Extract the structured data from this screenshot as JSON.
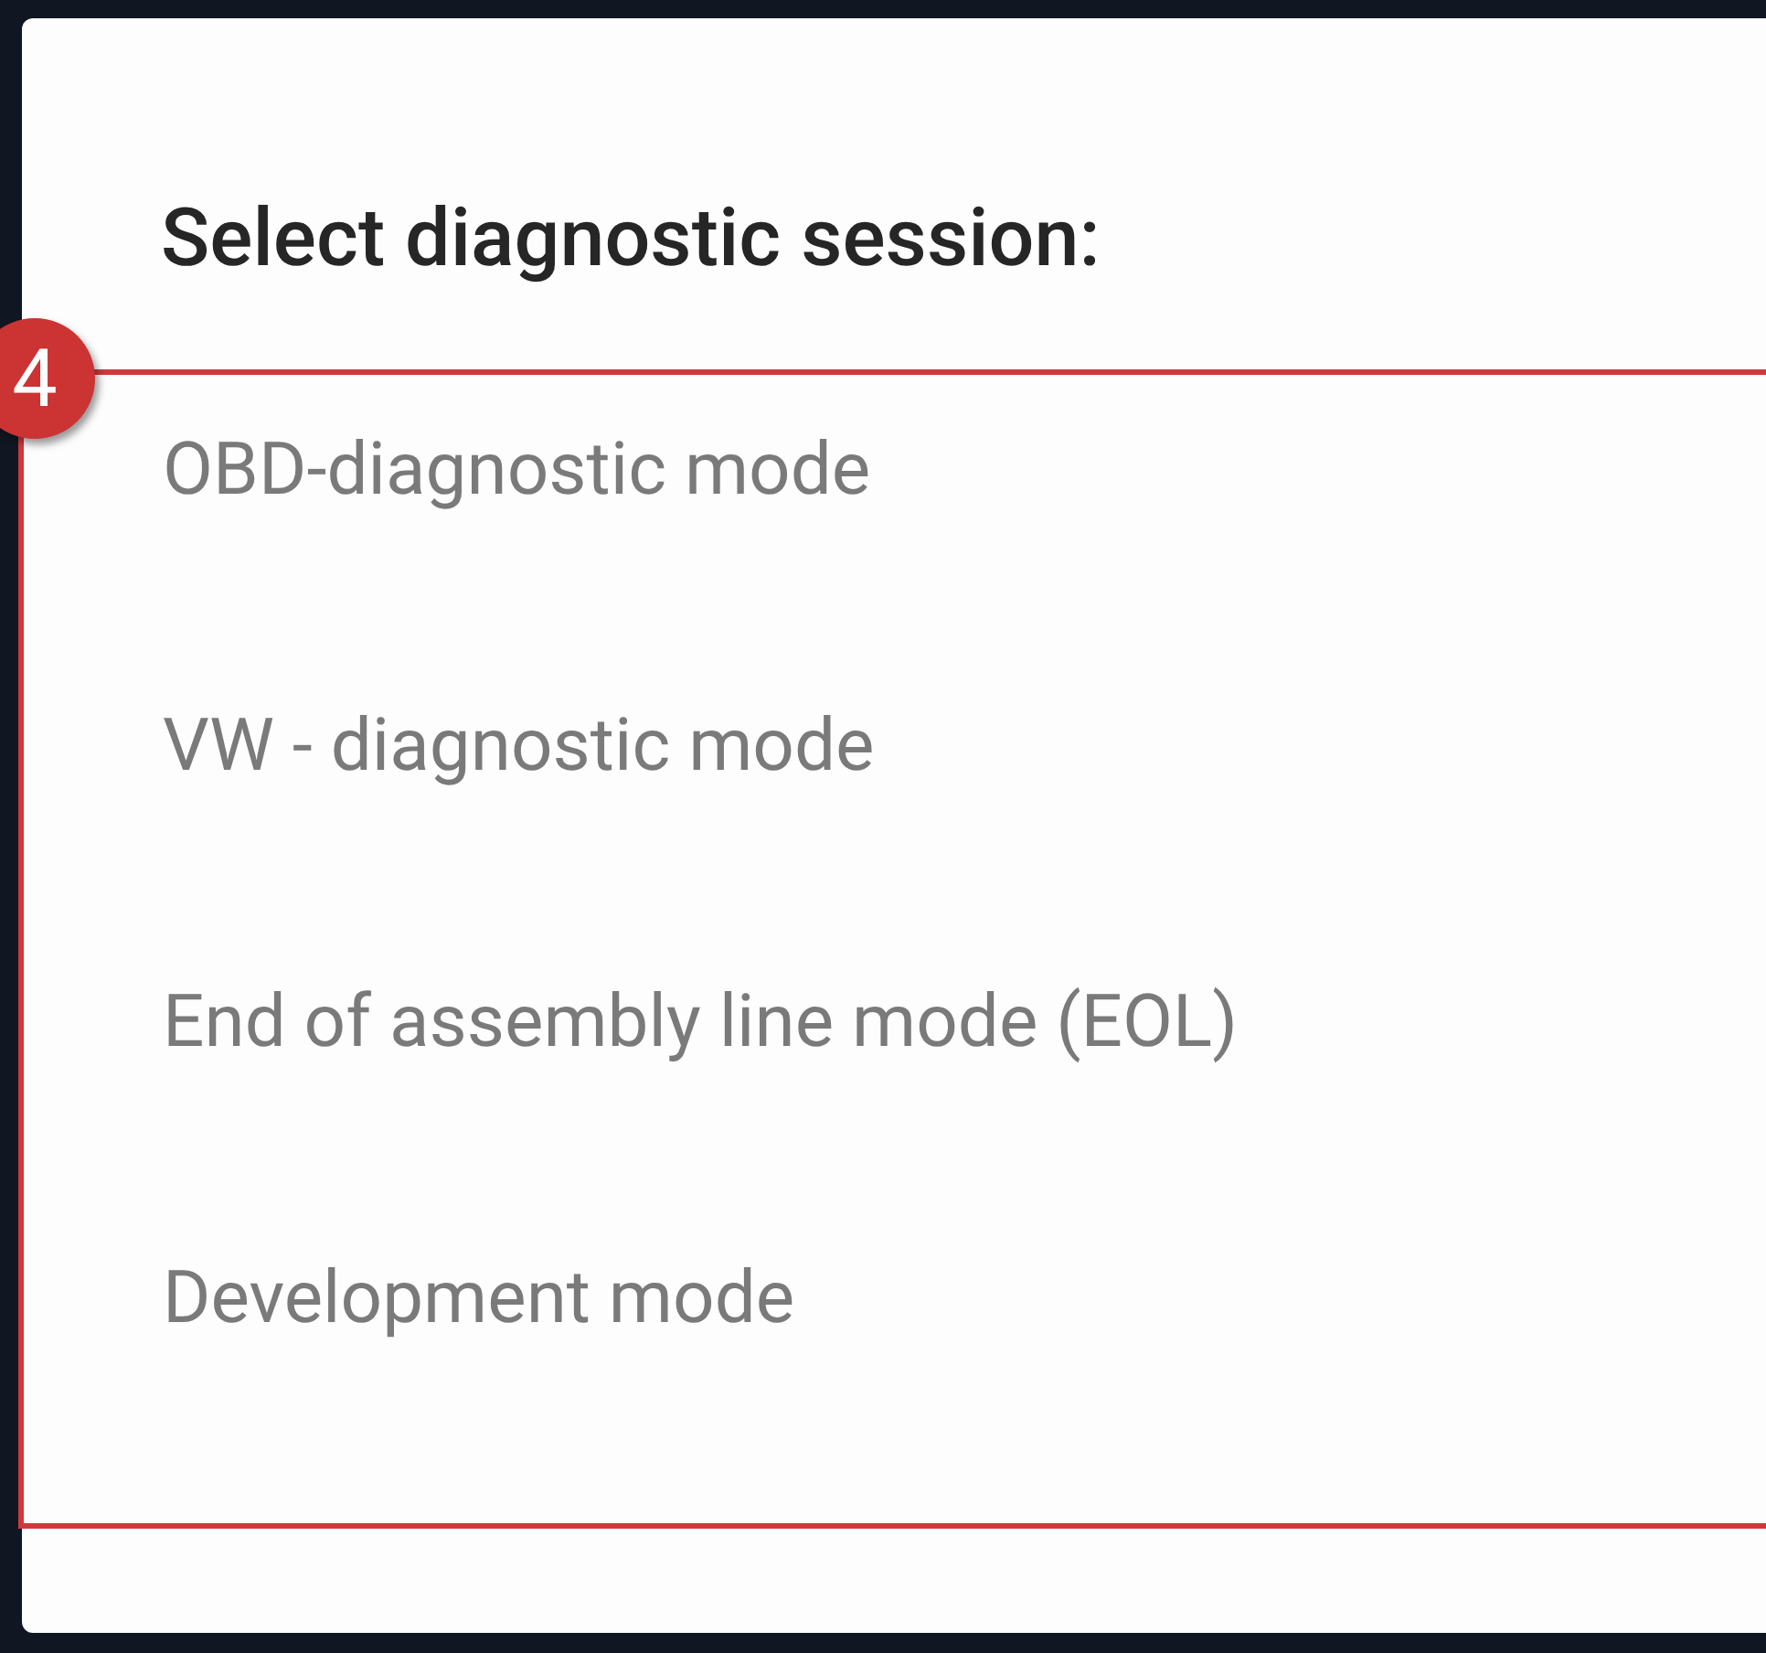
{
  "dialog": {
    "title": "Select diagnostic session:",
    "annotation": {
      "number": "4"
    },
    "options": [
      {
        "label": "OBD-diagnostic mode"
      },
      {
        "label": "VW - diagnostic mode"
      },
      {
        "label": "End of assembly line mode (EOL)"
      },
      {
        "label": "Development mode"
      }
    ]
  }
}
